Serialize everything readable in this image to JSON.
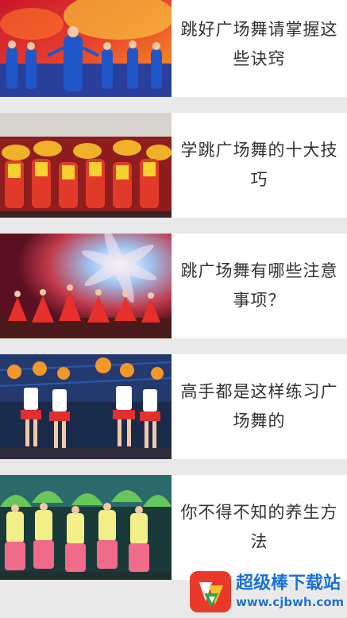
{
  "articles": [
    {
      "title": "跳好广场舞请掌握这些诀窍",
      "thumbnail": "dance-photo-blue-costumes"
    },
    {
      "title": "学跳广场舞的十大技巧",
      "thumbnail": "dance-photo-red-yellow-fans"
    },
    {
      "title": "跳广场舞有哪些注意事项？",
      "thumbnail": "dance-photo-red-dresses"
    },
    {
      "title": "高手都是这样练习广场舞的",
      "thumbnail": "dance-photo-cheerleaders"
    },
    {
      "title": "你不得不知的养生方法",
      "thumbnail": "dance-photo-green-fans"
    }
  ],
  "watermark": {
    "name": "超级棒下载站",
    "url": "www.cjbwh.com",
    "icon": "download-site-logo-icon"
  },
  "colors": {
    "background": "#e9e9e9",
    "card": "#ffffff",
    "title_text": "#333333",
    "watermark_blue": "#1a6fd6",
    "logo_red": "#e8392a"
  }
}
